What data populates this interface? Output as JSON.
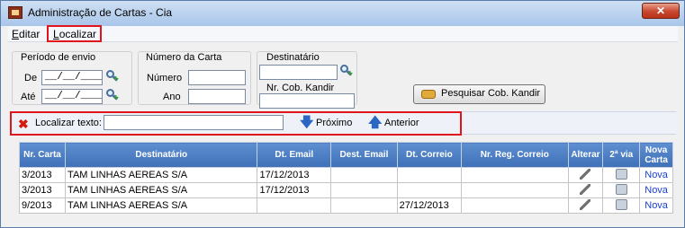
{
  "window": {
    "title": "Administração de Cartas - Cia",
    "close_label": "✕"
  },
  "menu": {
    "items": [
      {
        "label": "Editar",
        "mnemonic": "E",
        "rest": "ditar"
      },
      {
        "label": "Localizar",
        "mnemonic": "L",
        "rest": "ocalizar"
      }
    ]
  },
  "filters": {
    "periodo": {
      "heading": "Período de envio",
      "de_label": "De",
      "de_value": "__/__/____",
      "ate_label": "Até",
      "ate_value": "__/__/____"
    },
    "numero_carta": {
      "heading": "Número da Carta",
      "numero_label": "Número",
      "numero_value": "",
      "ano_label": "Ano",
      "ano_value": ""
    },
    "destinatario": {
      "heading": "Destinatário",
      "value": "",
      "nr_cob_label": "Nr. Cob. Kandir",
      "nr_cob_value": ""
    },
    "search_button_label": "Pesquisar Cob. Kandir"
  },
  "find": {
    "label": "Localizar texto:",
    "value": "",
    "next_label": "Próximo",
    "prev_label": "Anterior"
  },
  "grid": {
    "headers": [
      "Nr. Carta",
      "Destinatário",
      "Dt. Email",
      "Dest. Email",
      "Dt. Correio",
      "Nr. Reg. Correio",
      "Alterar",
      "2ª via",
      "Nova Carta"
    ],
    "rows": [
      {
        "nr": "3/2013",
        "dest": "TAM LINHAS AEREAS S/A",
        "dt_email": "17/12/2013",
        "dest_email": "",
        "dt_correio": "",
        "nr_reg": "",
        "nova": "Nova"
      },
      {
        "nr": "3/2013",
        "dest": "TAM LINHAS AEREAS S/A",
        "dt_email": "17/12/2013",
        "dest_email": "",
        "dt_correio": "",
        "nr_reg": "",
        "nova": "Nova"
      },
      {
        "nr": "9/2013",
        "dest": "TAM LINHAS AEREAS S/A",
        "dt_email": "",
        "dest_email": "",
        "dt_correio": "27/12/2013",
        "nr_reg": "",
        "nova": "Nova"
      }
    ]
  },
  "colors": {
    "highlight": "#e0141a",
    "grid_header": "#4a7cc3",
    "link": "#1a3fd0"
  }
}
